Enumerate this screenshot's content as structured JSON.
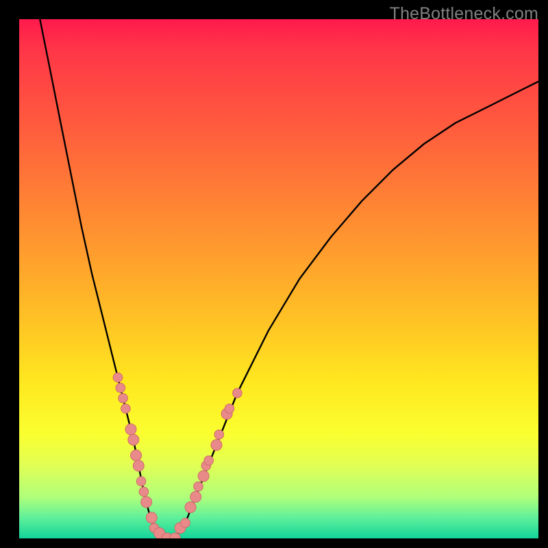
{
  "watermark": "TheBottleneck.com",
  "chart_data": {
    "type": "line",
    "title": "",
    "xlabel": "",
    "ylabel": "",
    "xlim": [
      0,
      100
    ],
    "ylim": [
      0,
      100
    ],
    "series": [
      {
        "name": "curve",
        "x": [
          4,
          6,
          8,
          10,
          12,
          14,
          16,
          18,
          20,
          21,
          22,
          23,
          24,
          25,
          26,
          28,
          30,
          32,
          34,
          38,
          42,
          48,
          54,
          60,
          66,
          72,
          78,
          84,
          90,
          96,
          100
        ],
        "y": [
          100,
          90,
          80,
          70,
          60,
          51,
          43,
          35,
          27,
          23,
          19,
          14,
          9,
          5,
          2,
          0,
          0,
          3,
          8,
          18,
          28,
          40,
          50,
          58,
          65,
          71,
          76,
          80,
          83,
          86,
          88
        ]
      }
    ],
    "markers": [
      {
        "x": 19.0,
        "y": 31,
        "r": 1.2
      },
      {
        "x": 19.5,
        "y": 29,
        "r": 1.2
      },
      {
        "x": 20.0,
        "y": 27,
        "r": 1.2
      },
      {
        "x": 20.5,
        "y": 25,
        "r": 1.2
      },
      {
        "x": 21.5,
        "y": 21,
        "r": 1.4
      },
      {
        "x": 22.0,
        "y": 19,
        "r": 1.4
      },
      {
        "x": 22.5,
        "y": 16,
        "r": 1.4
      },
      {
        "x": 23.0,
        "y": 14,
        "r": 1.4
      },
      {
        "x": 23.5,
        "y": 11,
        "r": 1.2
      },
      {
        "x": 24.0,
        "y": 9,
        "r": 1.2
      },
      {
        "x": 24.5,
        "y": 7,
        "r": 1.4
      },
      {
        "x": 25.5,
        "y": 4,
        "r": 1.4
      },
      {
        "x": 26.0,
        "y": 2,
        "r": 1.2
      },
      {
        "x": 27.0,
        "y": 1,
        "r": 1.4
      },
      {
        "x": 28.5,
        "y": 0,
        "r": 1.4
      },
      {
        "x": 30.0,
        "y": 0,
        "r": 1.4
      },
      {
        "x": 31.0,
        "y": 2,
        "r": 1.4
      },
      {
        "x": 32.0,
        "y": 3,
        "r": 1.2
      },
      {
        "x": 33.0,
        "y": 6,
        "r": 1.4
      },
      {
        "x": 34.0,
        "y": 8,
        "r": 1.4
      },
      {
        "x": 34.5,
        "y": 10,
        "r": 1.2
      },
      {
        "x": 35.5,
        "y": 12,
        "r": 1.4
      },
      {
        "x": 36.0,
        "y": 14,
        "r": 1.2
      },
      {
        "x": 36.5,
        "y": 15,
        "r": 1.2
      },
      {
        "x": 38.0,
        "y": 18,
        "r": 1.4
      },
      {
        "x": 38.5,
        "y": 20,
        "r": 1.2
      },
      {
        "x": 40.0,
        "y": 24,
        "r": 1.4
      },
      {
        "x": 40.5,
        "y": 25,
        "r": 1.2
      },
      {
        "x": 42.0,
        "y": 28,
        "r": 1.2
      }
    ],
    "colors": {
      "curve": "#000000",
      "marker_fill": "#e98a8a",
      "marker_stroke": "#d06a6a"
    }
  }
}
